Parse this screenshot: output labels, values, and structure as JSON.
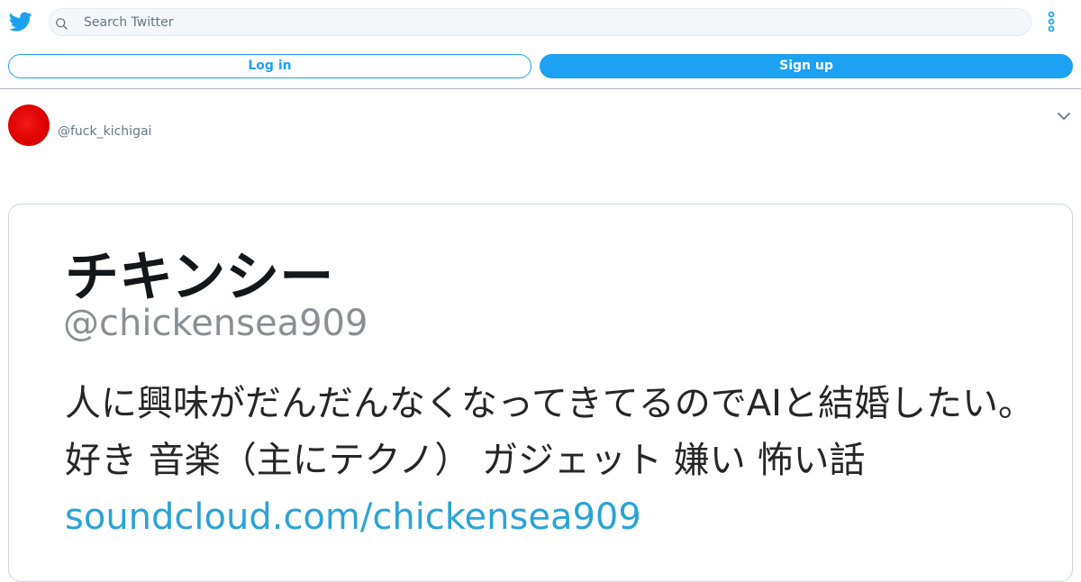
{
  "search": {
    "placeholder": "Search Twitter"
  },
  "auth": {
    "login_label": "Log in",
    "signup_label": "Sign up"
  },
  "tweet": {
    "author_handle": "@fuck_kichigai",
    "image": {
      "display_name": "チキンシー",
      "handle": "@chickensea909",
      "bio": "人に興味がだんだんなくなってきてるのでAIと結婚したい。 好き 音楽（主にテクノ） ガジェット 嫌い 怖い話 ",
      "link": "soundcloud.com/chickensea909"
    }
  },
  "icons": {
    "logo": "twitter-bird-icon",
    "search": "search-icon",
    "more": "more-vertical-icon",
    "caret": "chevron-down-icon"
  },
  "colors": {
    "brand": "#1da1f2",
    "muted_text": "#657786",
    "avatar": "#e00000",
    "link": "#2aa3d6"
  }
}
